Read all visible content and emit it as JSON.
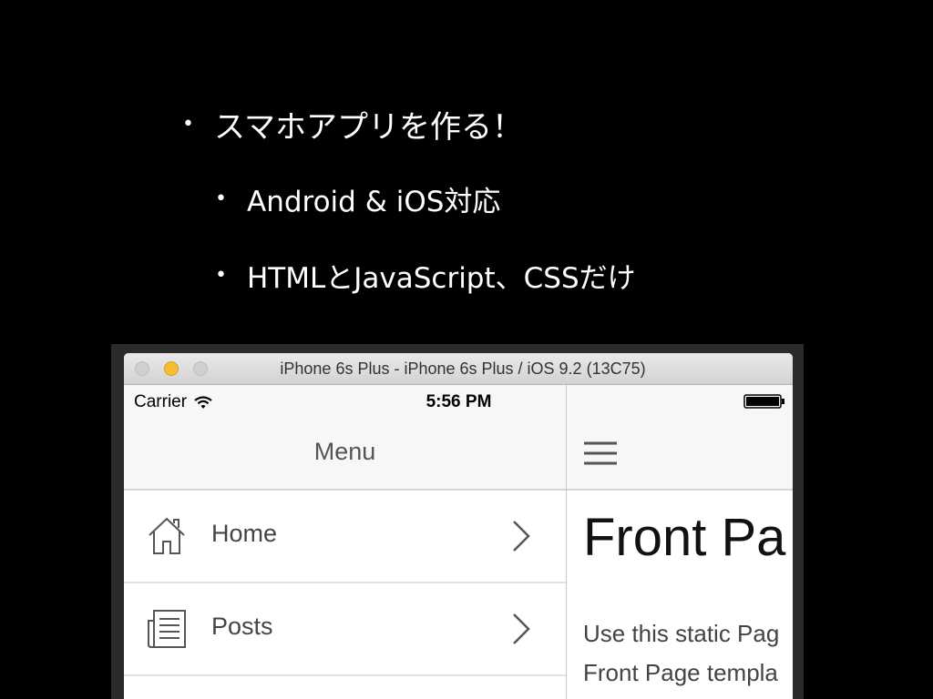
{
  "slide": {
    "bullets": [
      "スマホアプリを作る！",
      "Android & iOS対応",
      "HTMLとJavaScript、CSSだけ"
    ],
    "bullet_glyph": "•"
  },
  "simulator": {
    "window_title": "iPhone 6s Plus - iPhone 6s Plus / iOS 9.2 (13C75)",
    "status_bar": {
      "carrier": "Carrier",
      "time": "5:56 PM",
      "icons": [
        "wifi-icon",
        "battery-icon"
      ]
    },
    "menu": {
      "title": "Menu",
      "items": [
        {
          "label": "Home",
          "icon": "home-icon"
        },
        {
          "label": "Posts",
          "icon": "posts-icon"
        }
      ]
    },
    "content": {
      "heading": "Front Pa",
      "body_lines": [
        "Use this static Pag",
        "Front Page templa"
      ]
    },
    "colors": {
      "minimize_light": "#f6bd2f",
      "nav_background": "#f7f7f7"
    }
  }
}
